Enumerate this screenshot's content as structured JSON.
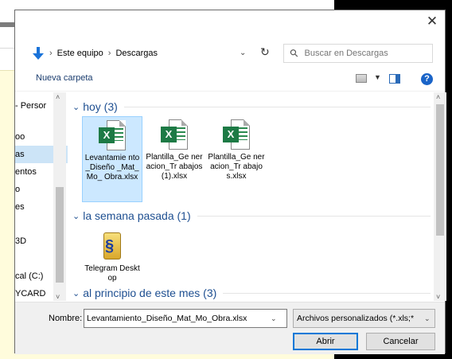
{
  "background": {
    "nav_fragments": [
      "- Persor",
      "oo",
      "as",
      "entos",
      "o",
      "es",
      "3D",
      "cal (C:)",
      "YCARD"
    ]
  },
  "dialog": {
    "close_glyph": "✕",
    "breadcrumb": [
      "Este equipo",
      "Descargas"
    ],
    "breadcrumb_sep": "›",
    "search_placeholder": "Buscar en Descargas",
    "new_folder_label": "Nueva carpeta",
    "help_label": "?",
    "groups": [
      {
        "label": "hoy (3)",
        "files": [
          {
            "name": "Levantamiento_Diseño_Mat_Mo_Obra.xlsx",
            "display": "Levantamie nto_Diseño _Mat_Mo_ Obra.xlsx",
            "icon": "excel-icon",
            "selected": true
          },
          {
            "name": "Plantilla_Generacion_Trabajos (1).xlsx",
            "display": "Plantilla_Ge neracion_Tr abajos (1).xlsx",
            "icon": "excel-icon",
            "selected": false
          },
          {
            "name": "Plantilla_Generacion_Trabajos.xlsx",
            "display": "Plantilla_Ge neracion_Tr abajos.xlsx",
            "icon": "excel-icon",
            "selected": false
          }
        ]
      },
      {
        "label": "la semana pasada (1)",
        "files": [
          {
            "name": "Telegram Desktop",
            "display": "Telegram Desktop",
            "icon": "telegram-folder-icon",
            "selected": false
          }
        ]
      },
      {
        "label": "al principio de este mes (3)",
        "files": []
      }
    ],
    "filename_label": "Nombre:",
    "filename_value": "Levantamiento_Diseño_Mat_Mo_Obra.xlsx",
    "filetype_value": "Archivos personalizados (*.xls;*",
    "open_label": "Abrir",
    "cancel_label": "Cancelar",
    "accent_color": "#0078d7",
    "selection_color": "#cce8ff"
  }
}
